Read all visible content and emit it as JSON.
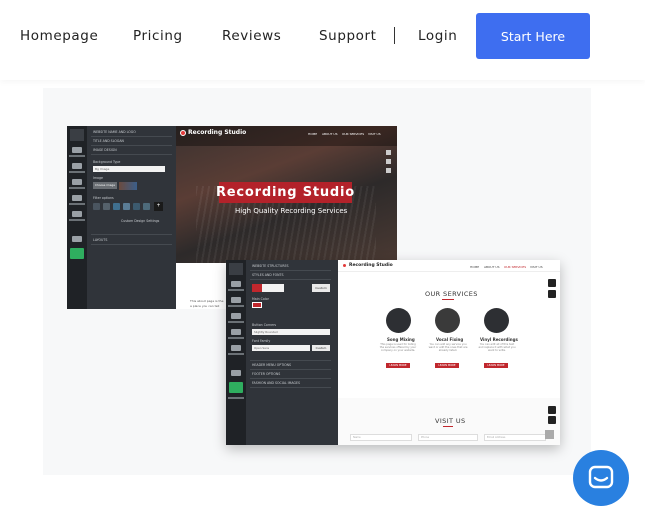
{
  "nav": {
    "links": [
      "Homepage",
      "Pricing",
      "Reviews",
      "Support"
    ],
    "login": "Login",
    "cta": "Start Here"
  },
  "colors": {
    "cta": "#3e6ef0",
    "chat": "#2980e0",
    "brand_red": "#c0272d"
  },
  "editor1": {
    "panel_sections": [
      "WEBSITE NAME AND LOGO",
      "TITLE AND SLOGAN",
      "IMAGE DESIGN",
      "LAYOUTS"
    ],
    "panel_labels": [
      "Background Type",
      "Image",
      "Filter options",
      "Custom Design Settings"
    ],
    "select_value": "Bg Image",
    "image_btn": "Choose image",
    "site_title": "Recording Studio",
    "site_menu": [
      "HOME",
      "ABOUT US",
      "OUR SERVICES",
      "VISIT US"
    ],
    "banner": "Recording Studio",
    "subtitle": "High Quality Recording Services",
    "about_text": "This about page is the",
    "about_text2": "a place you can tell",
    "rail_labels": [
      "WEBSITE",
      "PAGES",
      "DESIGN",
      "SETTINGS",
      "DOMAIN"
    ]
  },
  "editor2": {
    "panel_sections": [
      "WEBSITE STRUCTURES",
      "STYLES AND FONTS",
      "HEADER MENU OPTIONS",
      "FOOTER OPTIONS",
      "FASHION AND SOCIAL IMAGES"
    ],
    "labels": [
      "Main Color",
      "Button Corners",
      "Font Family"
    ],
    "corner_value": "Slightly Rounded",
    "font_value": "Open Sans",
    "custom": "Custom",
    "site_title": "Recording Studio",
    "site_menu": [
      "HOME",
      "ABOUT US",
      "OUR SERVICES",
      "VISIT US"
    ],
    "section1": "OUR SERVICES",
    "services": [
      {
        "title": "Song Mixing",
        "text": "This page is used for listing the services offered by your company on your website.",
        "btn": "LEARN MORE"
      },
      {
        "title": "Vocal Fixing",
        "text": "You can add any service you want or edit the ones that are already listed.",
        "btn": "LEARN MORE"
      },
      {
        "title": "Vinyl Recordings",
        "text": "You can edit all of this text and replace it with what you want to write.",
        "btn": "LEARN MORE"
      }
    ],
    "section2": "VISIT US",
    "fields": [
      "Name",
      "Phone",
      "Email Address"
    ],
    "rail_labels": [
      "WEBSITE",
      "PAGES",
      "DESIGN",
      "SETTINGS",
      "DOMAIN",
      "SAVE"
    ]
  }
}
